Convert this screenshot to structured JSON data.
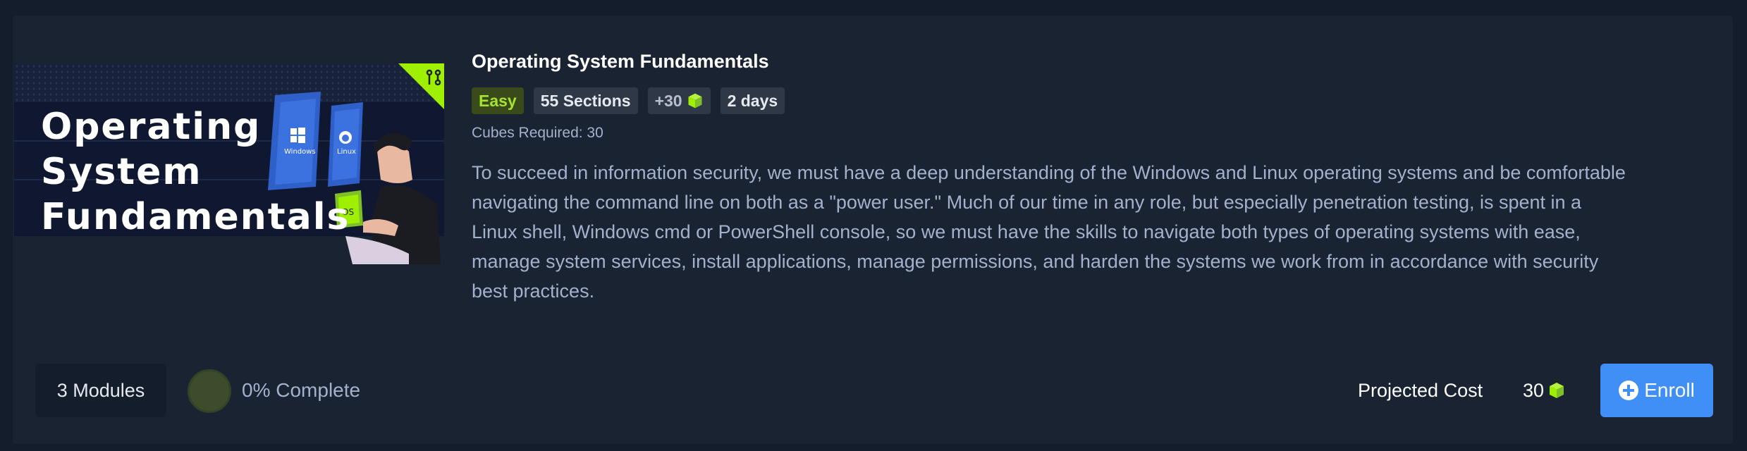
{
  "thumbnail": {
    "title_lines": [
      "Operating",
      "System",
      "Fundamentals"
    ],
    "window_labels": [
      "Windows",
      "Linux"
    ],
    "os_label": "OS",
    "corner_icon": "git-branch-icon"
  },
  "path": {
    "title": "Operating System Fundamentals",
    "difficulty": "Easy",
    "sections": "55 Sections",
    "cube_reward": "+30",
    "duration": "2 days",
    "cubes_required": "Cubes Required: 30",
    "description": "To succeed in information security, we must have a deep understanding of the Windows and Linux operating systems and be comfortable navigating the command line on both as a \"power user.\" Much of our time in any role, but especially penetration testing, is spent in a Linux shell, Windows cmd or PowerShell console, so we must have the skills to navigate both types of operating systems with ease, manage system services, install applications, manage permissions, and harden the systems we work from in accordance with security best practices."
  },
  "footer": {
    "modules": "3 Modules",
    "progress_percent": 0,
    "progress_text": "0% Complete",
    "cost_label": "Projected Cost",
    "cost_value": "30",
    "enroll_label": "Enroll"
  },
  "colors": {
    "background": "#141d2b",
    "card": "#1a2332",
    "accent_green": "#9fef00",
    "enroll_blue": "#3f8ff7",
    "easy_text": "#a4e32e"
  }
}
